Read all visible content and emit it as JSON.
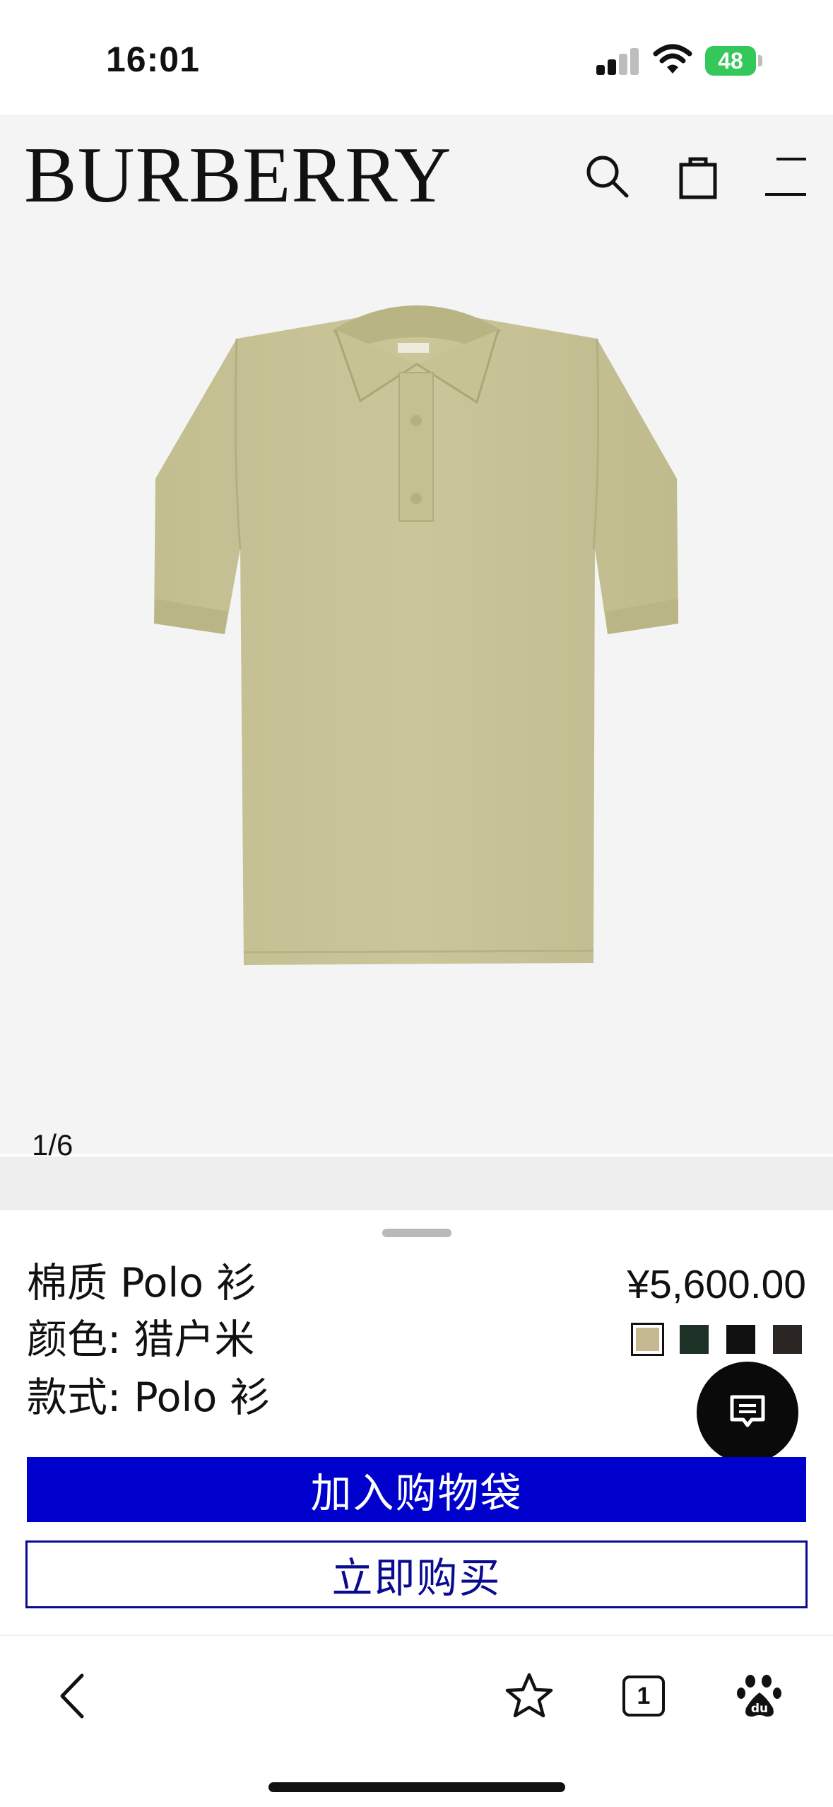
{
  "status_bar": {
    "time": "16:01",
    "battery": "48",
    "icons": [
      "signal-icon",
      "wifi-icon",
      "battery-charging-icon"
    ]
  },
  "header": {
    "brand": "BURBERRY",
    "icons": [
      "search-icon",
      "shopping-bag-icon",
      "menu-icon"
    ]
  },
  "gallery": {
    "counter": "1/6",
    "product_image": "polo-shirt-image",
    "garment_color": "#c8c497"
  },
  "product": {
    "name": "棉质 Polo 衫",
    "color_line": "颜色: 猎户米",
    "style_line": "款式: Polo 衫",
    "price": "¥5,600.00",
    "swatches": [
      {
        "color": "#c5b992",
        "selected": true
      },
      {
        "color": "#1d3127",
        "selected": false
      },
      {
        "color": "#111111",
        "selected": false
      },
      {
        "color": "#2b2623",
        "selected": false
      }
    ]
  },
  "actions": {
    "add_to_bag": "加入购物袋",
    "buy_now": "立即购买",
    "chat_icon": "chat-message-icon"
  },
  "browser_toolbar": {
    "tab_count": "1",
    "icons": [
      "back-chevron-icon",
      "star-bookmark-icon",
      "tabs-icon",
      "baidu-paw-icon"
    ]
  },
  "colors": {
    "primary_button": "#0000cc",
    "secondary_border": "#0b0b8f",
    "header_bg": "#f4f4f5",
    "battery_green": "#34c759"
  }
}
